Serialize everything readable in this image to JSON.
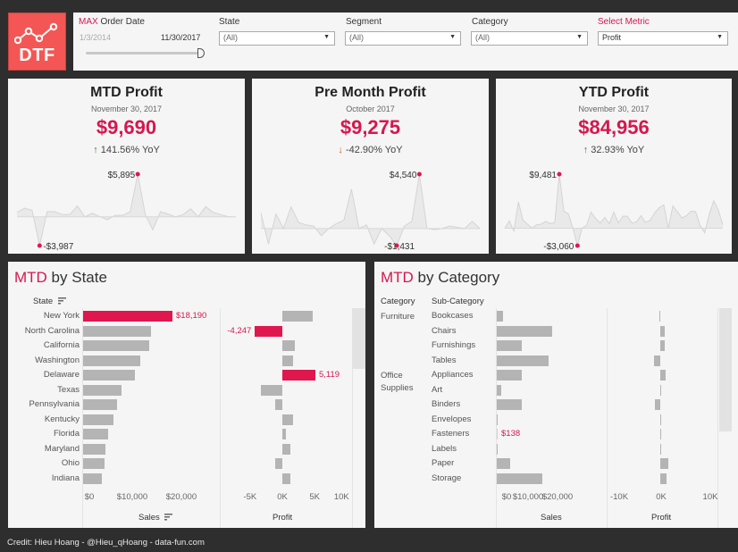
{
  "header": {
    "logo_text": "DTF",
    "filters": {
      "date": {
        "label_highlight": "MAX",
        "label_rest": " Order Date",
        "start": "1/3/2014",
        "end": "11/30/2017",
        "slider_fraction": 1.0
      },
      "state": {
        "label": "State",
        "value": "(All)"
      },
      "segment": {
        "label": "Segment",
        "value": "(All)"
      },
      "category": {
        "label": "Category",
        "value": "(All)"
      },
      "metric": {
        "label": "Select Metric",
        "value": "Profit"
      }
    },
    "accent_color": "#d6174e"
  },
  "kpis": [
    {
      "title": "MTD Profit",
      "date": "November 30, 2017",
      "value": "$9,690",
      "yoy_direction": "up",
      "yoy_arrow": "↑",
      "yoy": " 141.56% YoY",
      "max_label": "$5,895",
      "min_label": "-$3,987",
      "spark": [
        600,
        1200,
        900,
        -3987,
        700,
        700,
        300,
        300,
        1500,
        0,
        500,
        0,
        -400,
        200,
        200,
        700,
        5895,
        300,
        -1800,
        700,
        400,
        0,
        300,
        1100,
        0,
        1400,
        600,
        300,
        0,
        0
      ]
    },
    {
      "title": "Pre Month Profit",
      "date": "October 2017",
      "value": "$9,275",
      "yoy_direction": "down",
      "yoy_arrow": "↓",
      "yoy": " -42.90% YoY",
      "max_label": "$4,540",
      "min_label": "-$1,431",
      "spark": [
        1300,
        -1300,
        1200,
        0,
        1800,
        500,
        300,
        200,
        -600,
        0,
        400,
        700,
        3300,
        0,
        300,
        -1300,
        0,
        -600,
        -1431,
        200,
        600,
        4540,
        0,
        -100,
        0,
        200,
        100,
        0,
        600,
        0
      ]
    },
    {
      "title": "YTD Profit",
      "date": "November 30, 2017",
      "value": "$84,956",
      "yoy_direction": "up",
      "yoy_arrow": "↑",
      "yoy": " 32.93% YoY",
      "max_label": "$9,481",
      "min_label": "-$3,060",
      "spark": [
        0,
        1300,
        -500,
        4600,
        1400,
        700,
        0,
        600,
        700,
        1200,
        800,
        1000,
        9481,
        3000,
        2500,
        0,
        -3060,
        0,
        500,
        2800,
        1700,
        900,
        1900,
        800,
        2800,
        900,
        2100,
        2100,
        900,
        1100,
        2200,
        1000,
        1400,
        2700,
        3600,
        4100,
        0,
        3900,
        2900,
        1800,
        2200,
        3000,
        2900,
        500,
        -800,
        2400,
        4800,
        3200,
        600
      ]
    }
  ],
  "by_state": {
    "title_highlight": "MTD",
    "title_rest": " by State",
    "row_header": "State",
    "sales_axis_title": "Sales",
    "profit_axis_title": "Profit",
    "sales_ticks": [
      "$0",
      "$10,000",
      "$20,000"
    ],
    "profit_ticks": [
      "-5K",
      "0K",
      "5K",
      "10K"
    ],
    "rows": [
      {
        "state": "New York",
        "sales": 18190,
        "profit": 4650,
        "sales_label": "$18,190",
        "highlight_sales": true
      },
      {
        "state": "North Carolina",
        "sales": 13800,
        "profit": -4247,
        "profit_label": "-4,247",
        "highlight_profit": true
      },
      {
        "state": "California",
        "sales": 13450,
        "profit": 1900
      },
      {
        "state": "Washington",
        "sales": 11650,
        "profit": 1600
      },
      {
        "state": "Delaware",
        "sales": 10550,
        "profit": 5119,
        "profit_label": "5,119",
        "highlight_profit": true
      },
      {
        "state": "Texas",
        "sales": 7850,
        "profit": -3300
      },
      {
        "state": "Pennsylvania",
        "sales": 6950,
        "profit": -1100
      },
      {
        "state": "Kentucky",
        "sales": 6200,
        "profit": 1600
      },
      {
        "state": "Florida",
        "sales": 5100,
        "profit": 550
      },
      {
        "state": "Maryland",
        "sales": 4550,
        "profit": 1300
      },
      {
        "state": "Ohio",
        "sales": 4400,
        "profit": -1100
      },
      {
        "state": "Indiana",
        "sales": 3800,
        "profit": 1200
      }
    ]
  },
  "by_category": {
    "title_highlight": "MTD",
    "title_rest": " by Category",
    "col_header_category": "Category",
    "col_header_subcategory": "Sub-Category",
    "sales_axis_title": "Sales",
    "profit_axis_title": "Profit",
    "sales_ticks": [
      "$0",
      "$10,000",
      "$20,000"
    ],
    "profit_ticks": [
      "-10K",
      "0K",
      "10K"
    ],
    "groups": [
      {
        "category": "Furniture",
        "rows": [
          {
            "sub": "Bookcases",
            "sales": 1500,
            "profit": -150
          },
          {
            "sub": "Chairs",
            "sales": 12600,
            "profit": 900
          },
          {
            "sub": "Furnishings",
            "sales": 5700,
            "profit": 800
          },
          {
            "sub": "Tables",
            "sales": 11800,
            "profit": -1200
          }
        ]
      },
      {
        "category": "Office Supplies",
        "rows": [
          {
            "sub": "Appliances",
            "sales": 5700,
            "profit": 1100
          },
          {
            "sub": "Art",
            "sales": 1000,
            "profit": 200
          },
          {
            "sub": "Binders",
            "sales": 5600,
            "profit": -1000
          },
          {
            "sub": "Envelopes",
            "sales": 300,
            "profit": 100
          },
          {
            "sub": "Fasteners",
            "sales": 138,
            "profit": 50,
            "sales_label": "$138",
            "highlight_sales": true
          },
          {
            "sub": "Labels",
            "sales": 50,
            "profit": 50
          },
          {
            "sub": "Paper",
            "sales": 3000,
            "profit": 1500
          },
          {
            "sub": "Storage",
            "sales": 10300,
            "profit": 1300
          }
        ]
      }
    ]
  },
  "credit": "Credit: Hieu Hoang - @Hieu_qHoang - data-fun.com"
}
